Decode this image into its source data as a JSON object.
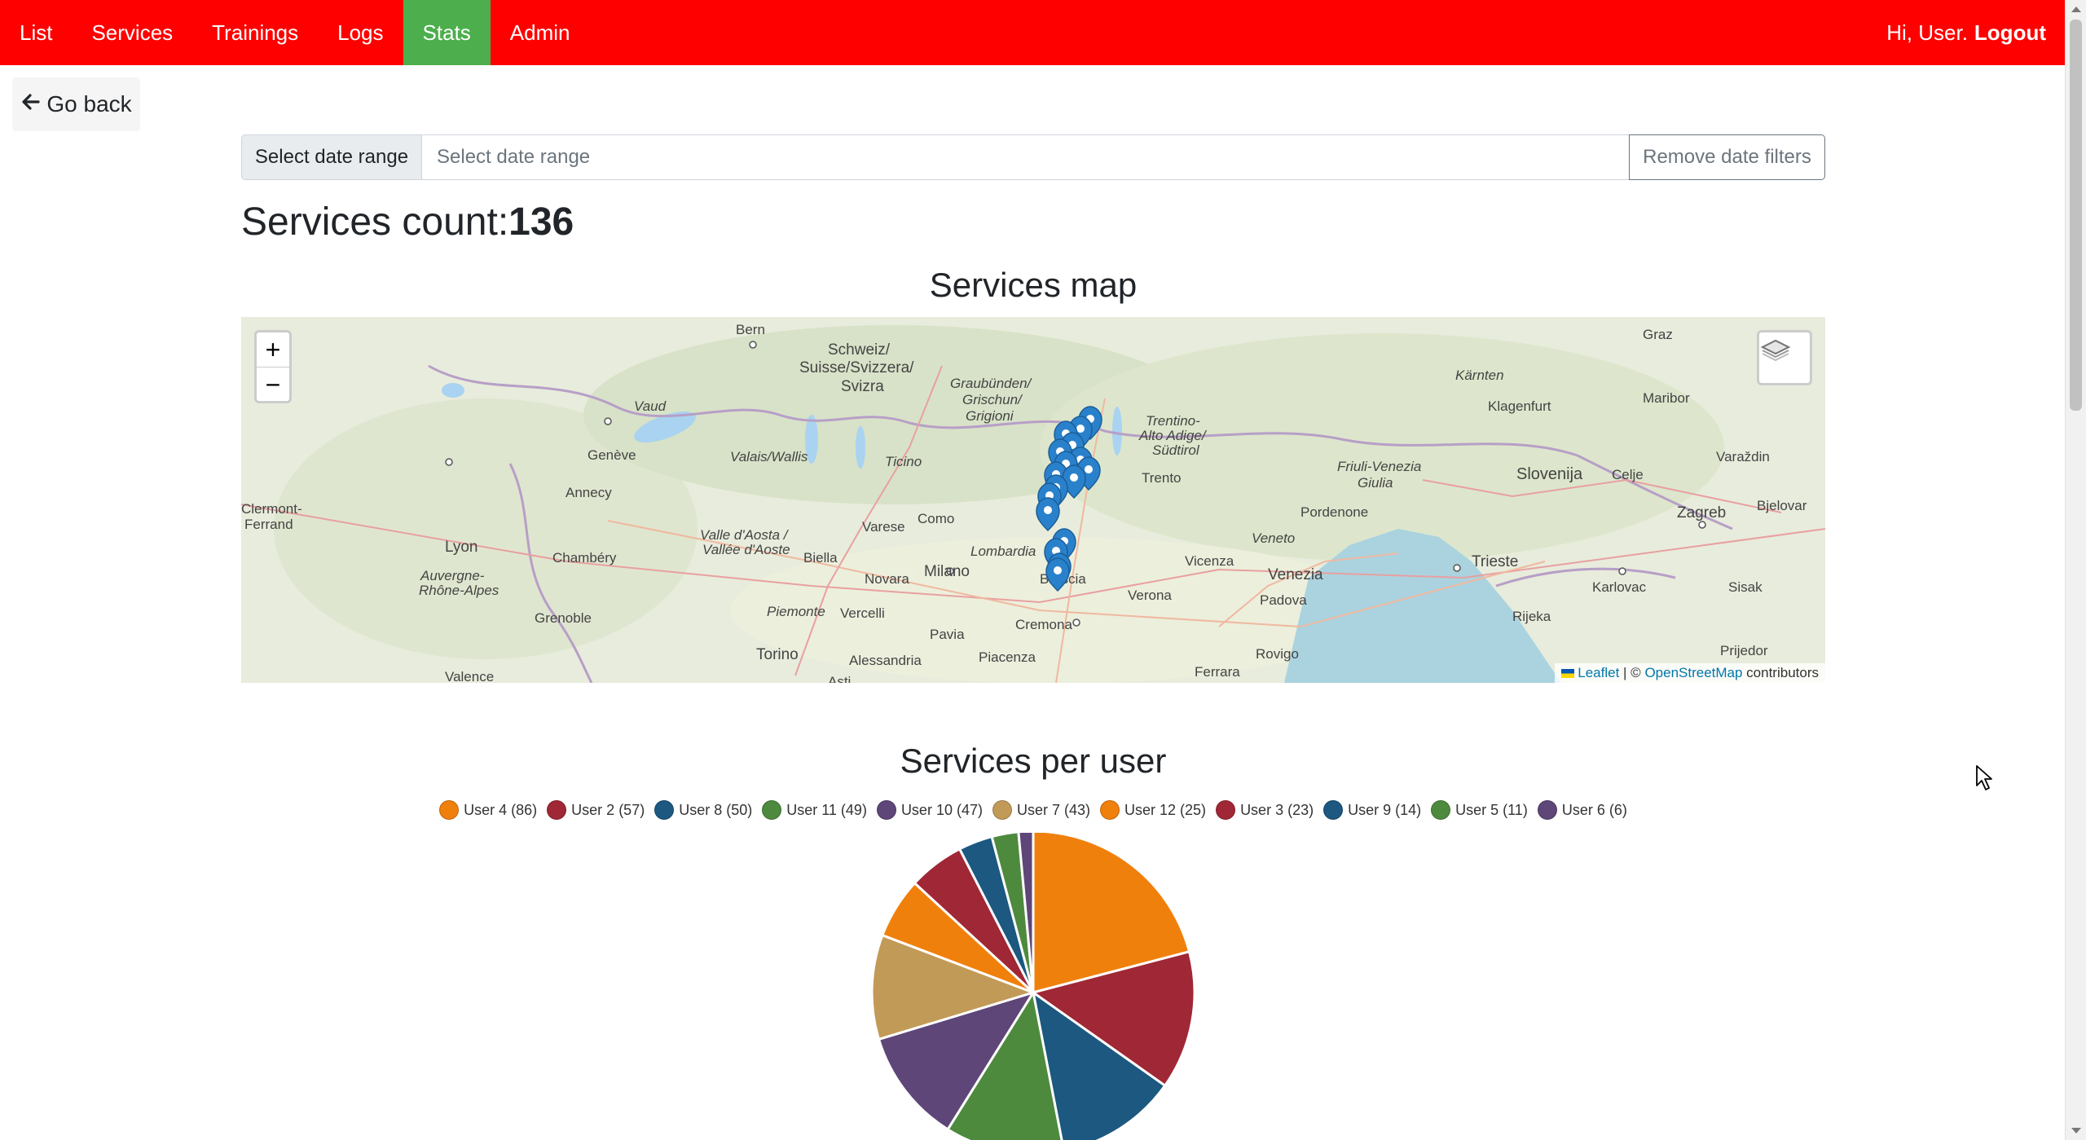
{
  "navbar": {
    "items": [
      {
        "label": "List"
      },
      {
        "label": "Services"
      },
      {
        "label": "Trainings"
      },
      {
        "label": "Logs"
      },
      {
        "label": "Stats",
        "active": true
      },
      {
        "label": "Admin"
      }
    ],
    "greeting": "Hi, User.",
    "logout": "Logout",
    "color": "#ff0000",
    "active_color": "#4cae4c"
  },
  "go_back": {
    "label": "Go back",
    "icon": "arrow-left-icon"
  },
  "date_filter": {
    "label": "Select date range",
    "placeholder": "Select date range",
    "value": "",
    "remove_label": "Remove date filters"
  },
  "services_count": {
    "label": "Services count:",
    "value": "136"
  },
  "map": {
    "title": "Services map",
    "zoom_in": "+",
    "zoom_out": "−",
    "attribution_leaflet": "Leaflet",
    "attribution_sep": " | © ",
    "attribution_osm": "OpenStreetMap",
    "attribution_suffix": " contributors",
    "place_labels": [
      "Bern",
      "Schweiz/",
      "Suisse/Svizzera/",
      "Svizra",
      "Graubünden/",
      "Grischun/",
      "Grigioni",
      "Trentino-",
      "Alto Adige/",
      "Südtirol",
      "Vaud",
      "Genève",
      "Valais/Wallis",
      "Ticino",
      "Varese",
      "Como",
      "Clermont-",
      "Ferrand",
      "Lyon",
      "Auvergne-",
      "Rhône-Alpes",
      "Annecy",
      "Chambéry",
      "Grenoble",
      "Valle d'Aosta /",
      "Vallée d'Aoste",
      "Biella",
      "Novara",
      "Milano",
      "Lombardia",
      "Vercelli",
      "Piemonte",
      "Pavia",
      "Torino",
      "Alessandria",
      "Piacenza",
      "Cremona",
      "Asti",
      "Valence",
      "Brescia",
      "Verona",
      "Trento",
      "Vicenza",
      "Padova",
      "Venezia",
      "Veneto",
      "Rovigo",
      "Ferrara",
      "Pordenone",
      "Friuli-Venezia",
      "Giulia",
      "Trieste",
      "Slovenija",
      "Celje",
      "Zagreb",
      "Karlovac",
      "Sisak",
      "Rijeka",
      "Prijedor",
      "Bjelovar",
      "Varaždin",
      "Maribor",
      "Graz",
      "Kärnten",
      "Klagenfurt"
    ]
  },
  "pie": {
    "title": "Services per user",
    "chart_data": {
      "type": "pie",
      "title": "Services per user",
      "legend_placement": "top",
      "series": [
        {
          "name": "User 4",
          "value": 86,
          "color": "#f0800c"
        },
        {
          "name": "User 2",
          "value": 57,
          "color": "#a02735"
        },
        {
          "name": "User 8",
          "value": 50,
          "color": "#1c5880"
        },
        {
          "name": "User 11",
          "value": 49,
          "color": "#4e8a3e"
        },
        {
          "name": "User 10",
          "value": 47,
          "color": "#5e4678"
        },
        {
          "name": "User 7",
          "value": 43,
          "color": "#c29a58"
        },
        {
          "name": "User 12",
          "value": 25,
          "color": "#f0800c"
        },
        {
          "name": "User 3",
          "value": 23,
          "color": "#a02735"
        },
        {
          "name": "User 9",
          "value": 14,
          "color": "#1c5880"
        },
        {
          "name": "User 5",
          "value": 11,
          "color": "#4e8a3e"
        },
        {
          "name": "User 6",
          "value": 6,
          "color": "#5e4678"
        }
      ],
      "legend_labels": [
        "User 4 (86)",
        "User 2 (57)",
        "User 8 (50)",
        "User 11 (49)",
        "User 10 (47)",
        "User 7 (43)",
        "User 12 (25)",
        "User 3 (23)",
        "User 9 (14)",
        "User 5 (11)",
        "User 6 (6)"
      ]
    }
  }
}
